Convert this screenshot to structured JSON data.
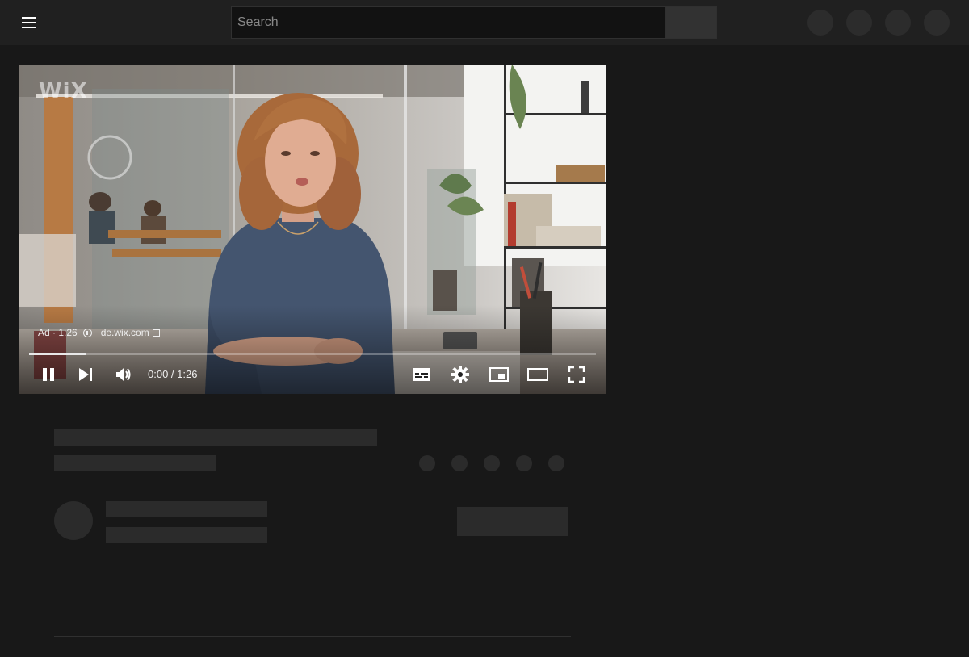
{
  "header": {
    "search_placeholder": "Search",
    "icons": [
      "menu-icon",
      "search-icon",
      "placeholder-circle",
      "placeholder-circle",
      "placeholder-circle",
      "placeholder-circle"
    ]
  },
  "player": {
    "logo_text": "WiX",
    "ad_label": "Ad · 1:26",
    "ad_domain": "de.wix.com",
    "time_display": "0:00 / 1:26",
    "progress": 0.1,
    "controls": [
      "pause-icon",
      "next-icon",
      "volume-icon",
      "subtitles-icon",
      "settings-icon",
      "miniplayer-icon",
      "theater-icon",
      "fullscreen-icon"
    ]
  },
  "colors": {
    "background": "#181818",
    "topbar": "#202020",
    "skeleton": "#2b2b2b"
  }
}
